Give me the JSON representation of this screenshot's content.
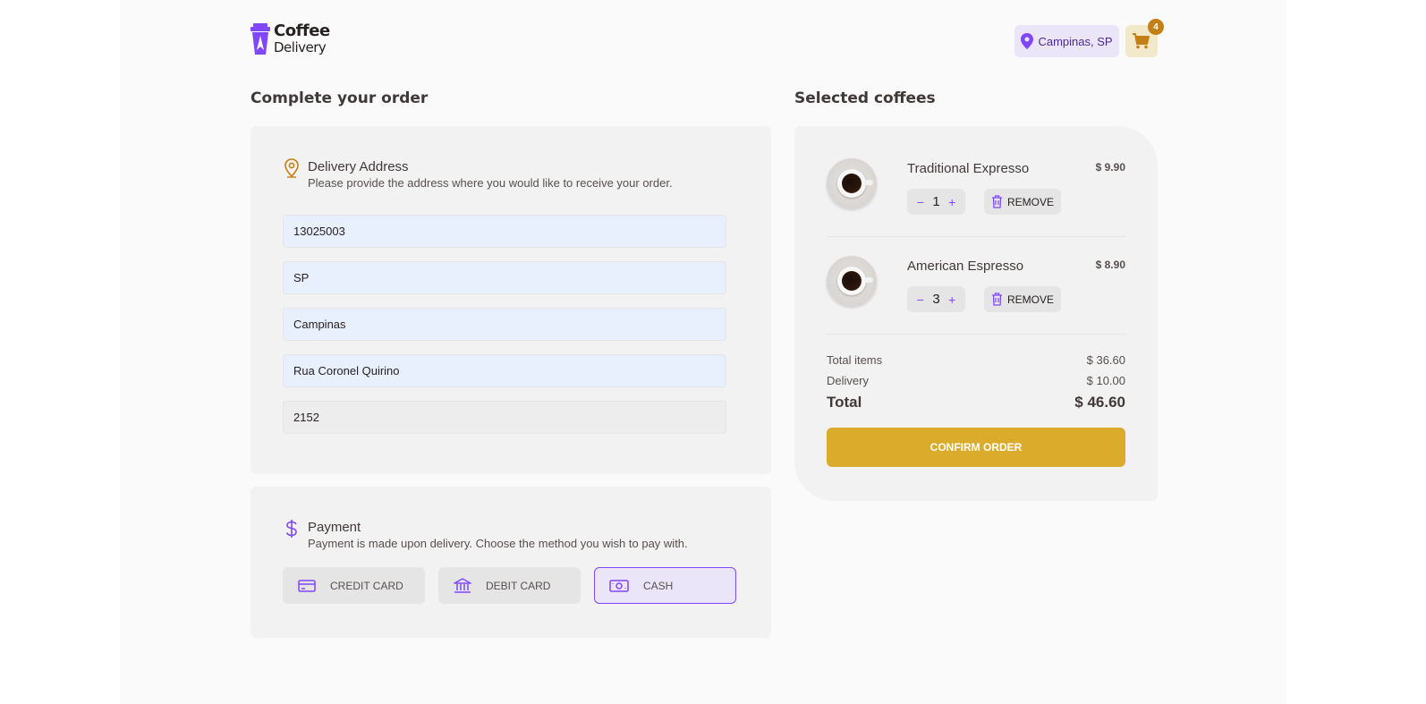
{
  "header": {
    "logo_line1": "Coffee",
    "logo_line2": "Delivery",
    "location": "Campinas, SP",
    "cart_count": "4"
  },
  "order": {
    "title": "Complete your order",
    "address": {
      "heading": "Delivery Address",
      "subheading": "Please provide the address where you would like to receive your order.",
      "fields": [
        "13025003",
        "SP",
        "Campinas",
        "Rua Coronel Quirino",
        "2152"
      ]
    },
    "payment": {
      "heading": "Payment",
      "subheading": "Payment is made upon delivery. Choose the method you wish to pay with.",
      "options": [
        "CREDIT CARD",
        "DEBIT CARD",
        "CASH"
      ],
      "selected": "CASH"
    }
  },
  "cart": {
    "title": "Selected coffees",
    "items": [
      {
        "name": "Traditional Expresso",
        "price": "$ 9.90",
        "quantity": "1",
        "remove_label": "REMOVE"
      },
      {
        "name": "American Espresso",
        "price": "$ 8.90",
        "quantity": "3",
        "remove_label": "REMOVE"
      }
    ],
    "summary": {
      "items_label": "Total items",
      "items_value": "$ 36.60",
      "delivery_label": "Delivery",
      "delivery_value": "$ 10.00",
      "total_label": "Total",
      "total_value": "$ 46.60"
    },
    "confirm_label": "CONFIRM ORDER"
  },
  "colors": {
    "brand_purple": "#8047f8",
    "brand_yellow": "#dbac2c",
    "accent_yellow_dark": "#c47f17"
  }
}
